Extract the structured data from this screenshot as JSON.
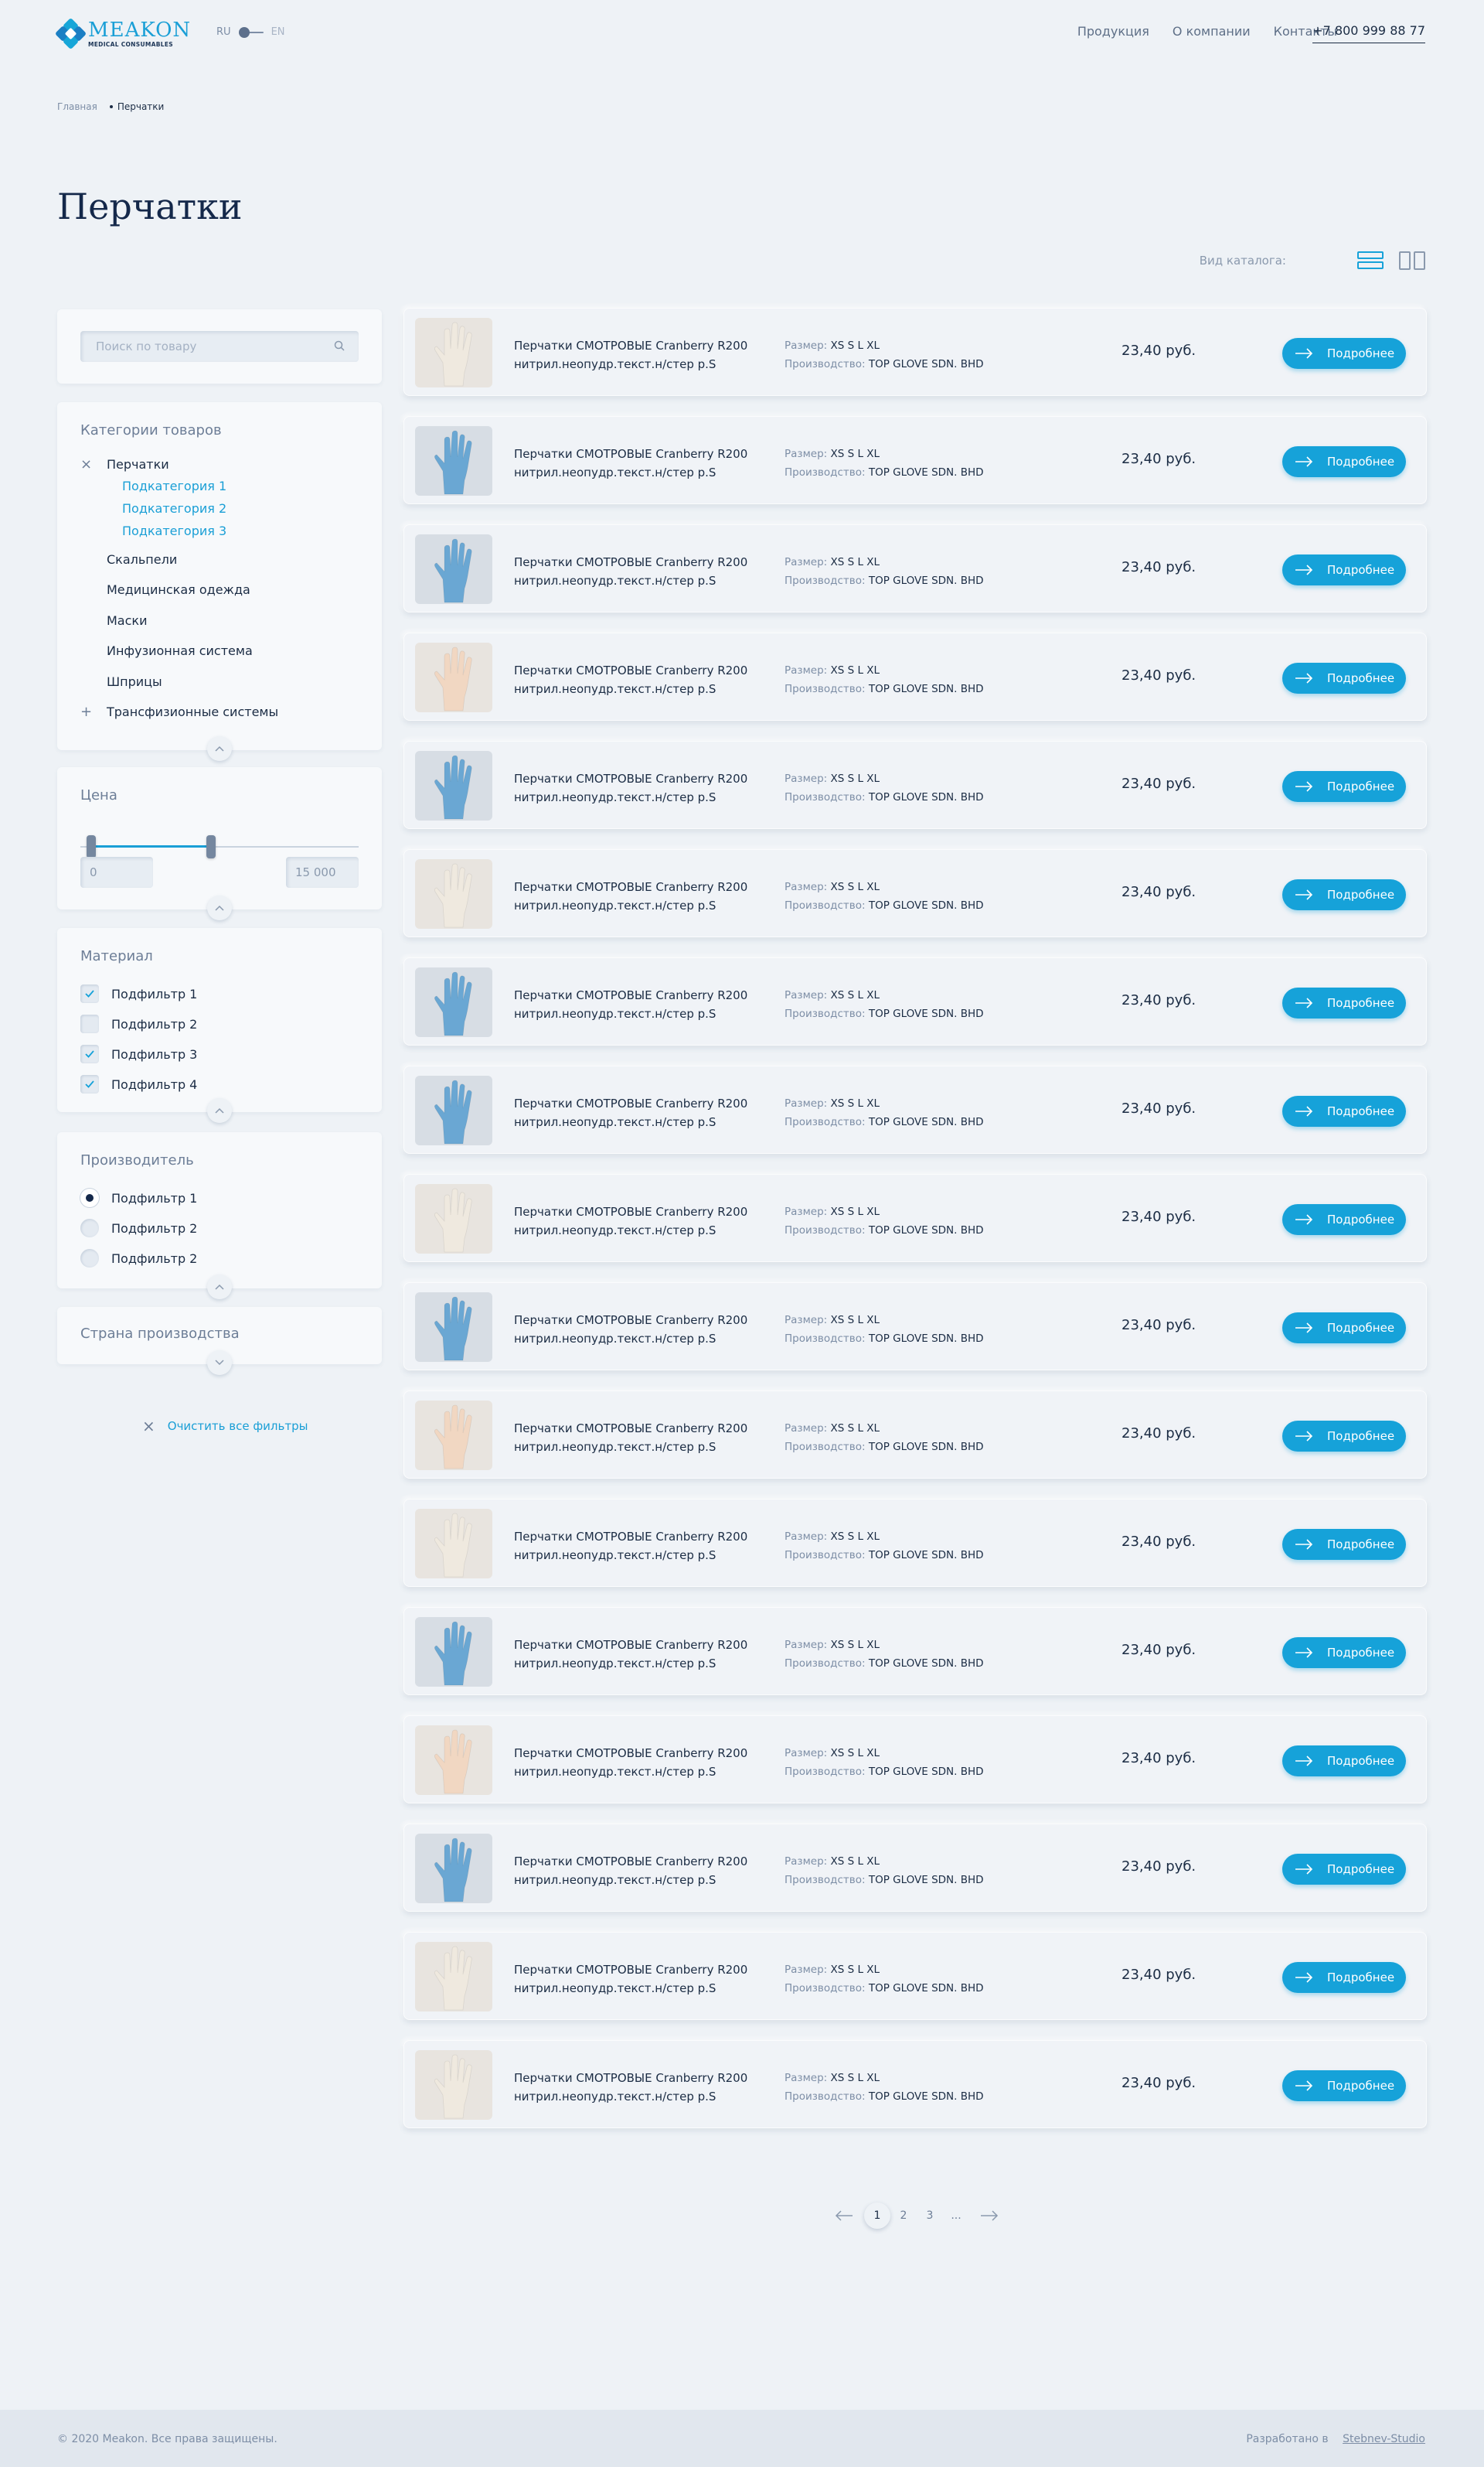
{
  "header": {
    "logo_title": "MEAKON",
    "logo_subtitle": "MEDICAL CONSUMABLES",
    "lang_ru": "RU",
    "lang_en": "EN",
    "nav": [
      "Продукция",
      "О компании",
      "Контакты"
    ],
    "phone": "+7 800 999 88 77"
  },
  "breadcrumb": {
    "home": "Главная",
    "current": "Перчатки"
  },
  "page_title": "Перчатки",
  "view": {
    "label": "Вид каталога:",
    "active": "list"
  },
  "sidebar": {
    "search_placeholder": "Поиск по товару",
    "categories_title": "Категории товаров",
    "categories": {
      "active": "Перчатки",
      "subcategories": [
        "Подкатегория 1",
        "Подкатегория 2",
        "Подкатегория 3"
      ],
      "others": [
        "Скальпели",
        "Медицинская одежда",
        "Маски",
        "Инфузионная система",
        "Шприцы"
      ],
      "expandable": "Трансфизионные системы"
    },
    "price_title": "Цена",
    "price_min": "0",
    "price_max": "15 000",
    "price_range_fraction": [
      0.04,
      0.47
    ],
    "material_title": "Материал",
    "materials": [
      {
        "label": "Подфильтр 1",
        "checked": true
      },
      {
        "label": "Подфильтр 2",
        "checked": false
      },
      {
        "label": "Подфильтр 3",
        "checked": true
      },
      {
        "label": "Подфильтр 4",
        "checked": true
      }
    ],
    "manufacturer_title": "Производитель",
    "manufacturers": [
      {
        "label": "Подфильтр 1",
        "selected": true
      },
      {
        "label": "Подфильтр 2",
        "selected": false
      },
      {
        "label": "Подфильтр 2",
        "selected": false
      }
    ],
    "country_title": "Страна производства",
    "clear_label": "Очистить все фильтры"
  },
  "product_template": {
    "name_line1": "Перчатки СМОТРОВЫЕ Cranberry R200",
    "name_line2": "нитрил.неопудр.текст.н/стер р.S",
    "size_label": "Размер:",
    "sizes": "XS  S  L  XL",
    "maker_label": "Производство:",
    "maker": "TOP GLOVE SDN. BHD",
    "price": "23,40 руб.",
    "button": "Подробнее"
  },
  "products": [
    {
      "glove": "white"
    },
    {
      "glove": "blue"
    },
    {
      "glove": "blue"
    },
    {
      "glove": "skin"
    },
    {
      "glove": "blue"
    },
    {
      "glove": "white"
    },
    {
      "glove": "blue"
    },
    {
      "glove": "blue"
    },
    {
      "glove": "white"
    },
    {
      "glove": "blue"
    },
    {
      "glove": "skin"
    },
    {
      "glove": "white"
    },
    {
      "glove": "blue"
    },
    {
      "glove": "skin"
    },
    {
      "glove": "blue"
    },
    {
      "glove": "white"
    },
    {
      "glove": "white"
    }
  ],
  "pagination": {
    "pages": [
      "1",
      "2",
      "3",
      "..."
    ],
    "current": "1"
  },
  "footer": {
    "copyright": "© 2020 Meakon. Все права защищены.",
    "dev_label": "Разработано в",
    "dev_link": "Stebnev-Studio"
  },
  "colors": {
    "accent": "#16a2d9",
    "background": "#eef2f6",
    "text": "#1b2c44",
    "glove_white": "#efe9df",
    "glove_blue": "#6aa7d3",
    "glove_skin": "#f1d7c2"
  }
}
